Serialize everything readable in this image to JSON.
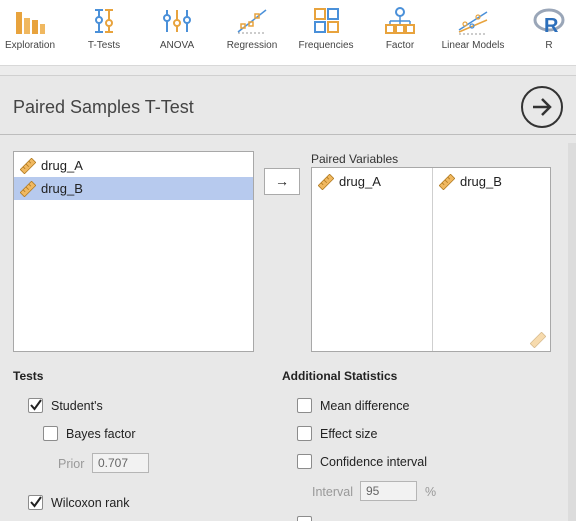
{
  "ribbon": {
    "items": [
      {
        "label": "Exploration",
        "icon": "exploration-icon"
      },
      {
        "label": "T-Tests",
        "icon": "t-tests-icon"
      },
      {
        "label": "ANOVA",
        "icon": "anova-icon"
      },
      {
        "label": "Regression",
        "icon": "regression-icon"
      },
      {
        "label": "Frequencies",
        "icon": "frequencies-icon"
      },
      {
        "label": "Factor",
        "icon": "factor-icon"
      },
      {
        "label": "Linear Models",
        "icon": "linear-models-icon"
      },
      {
        "label": "R",
        "icon": "r-icon"
      }
    ]
  },
  "analysis": {
    "title": "Paired Samples T-Test"
  },
  "variables": {
    "items": [
      {
        "name": "drug_A",
        "selected": false
      },
      {
        "name": "drug_B",
        "selected": true
      }
    ]
  },
  "transfer": {
    "arrow": "→"
  },
  "paired": {
    "label": "Paired Variables",
    "pair": [
      "drug_A",
      "drug_B"
    ]
  },
  "tests": {
    "title": "Tests",
    "students": {
      "label": "Student's",
      "checked": true
    },
    "bayes": {
      "label": "Bayes factor",
      "checked": false
    },
    "prior": {
      "label": "Prior",
      "value": "0.707"
    },
    "wilcoxon": {
      "label": "Wilcoxon rank",
      "checked": true
    }
  },
  "additional": {
    "title": "Additional Statistics",
    "mean_diff": {
      "label": "Mean difference",
      "checked": false
    },
    "effect_size": {
      "label": "Effect size",
      "checked": false
    },
    "conf_interval": {
      "label": "Confidence interval",
      "checked": false
    },
    "interval": {
      "label": "Interval",
      "value": "95",
      "unit": "%"
    }
  },
  "colors": {
    "accent_orange": "#e8a33d",
    "accent_blue": "#4a90d9",
    "selection": "#b7caee"
  }
}
